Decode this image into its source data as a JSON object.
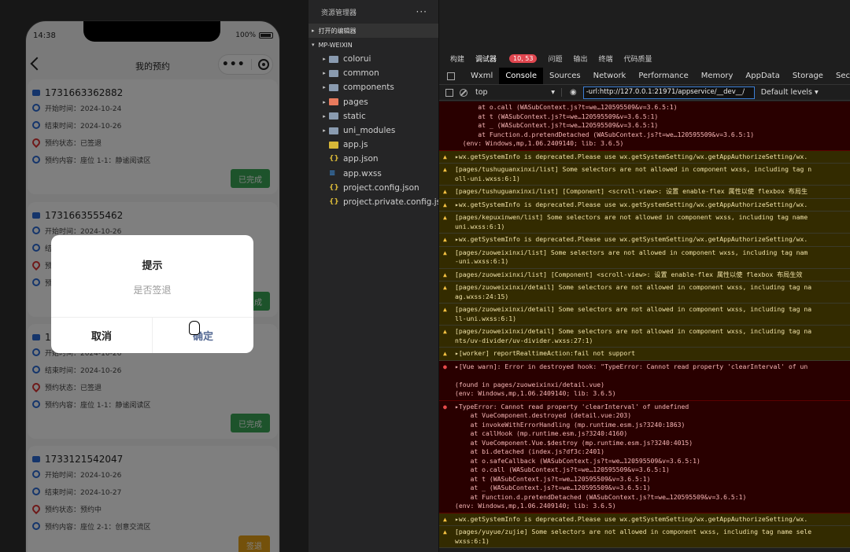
{
  "simulator": {
    "status_time": "14:38",
    "battery": "100%",
    "nav_title": "我的预约",
    "capsule_more": "•••",
    "cards": [
      {
        "id": "1731663362882",
        "start": "开始时间：2024-10-24",
        "end": "结束时间：2024-10-26",
        "status": "预约状态：已签退",
        "content": "预约内容：座位 1-1：静谧阅读区",
        "button": "已完成",
        "button_color": "#3aa757"
      },
      {
        "id": "1731663555462",
        "start": "开始时间：2024-10-26",
        "end": "结",
        "status": "预",
        "content": "预",
        "button": "成",
        "button_color": "#3aa757"
      },
      {
        "id": "1",
        "start": "开始时间：2024-10-26",
        "end": "结束时间：2024-10-26",
        "status": "预约状态：已签退",
        "content": "预约内容：座位 1-1：静谧阅读区",
        "button": "已完成",
        "button_color": "#3aa757"
      },
      {
        "id": "1733121542047",
        "start": "开始时间：2024-10-26",
        "end": "结束时间：2024-10-27",
        "status": "预约状态：预约中",
        "content": "预约内容：座位 2-1：创意交流区",
        "button": "签退",
        "button_color": "#e8a317"
      }
    ],
    "modal": {
      "title": "提示",
      "message": "是否签退",
      "cancel": "取消",
      "confirm": "确定"
    }
  },
  "explorer": {
    "title": "资源管理器",
    "more": "···",
    "section_open": "打开的编辑器",
    "section_project": "MP-WEIXIN",
    "items": [
      {
        "name": "colorui",
        "type": "folder"
      },
      {
        "name": "common",
        "type": "folder"
      },
      {
        "name": "components",
        "type": "folder"
      },
      {
        "name": "pages",
        "type": "pages"
      },
      {
        "name": "static",
        "type": "folder"
      },
      {
        "name": "uni_modules",
        "type": "folder"
      },
      {
        "name": "app.js",
        "type": "js"
      },
      {
        "name": "app.json",
        "type": "json"
      },
      {
        "name": "app.wxss",
        "type": "wxss"
      },
      {
        "name": "project.config.json",
        "type": "json"
      },
      {
        "name": "project.private.config.js...",
        "type": "json"
      }
    ]
  },
  "devtools": {
    "top_tabs": [
      "构建",
      "调试器",
      "问题",
      "输出",
      "终端",
      "代码质量"
    ],
    "badge": "10, 53",
    "tabs": [
      "Wxml",
      "Console",
      "Sources",
      "Network",
      "Performance",
      "Memory",
      "AppData",
      "Storage",
      "Securit"
    ],
    "context": "top",
    "filter": "-url:http://127.0.0.1:21971/appservice/__dev__/",
    "levels": "Default levels ▾",
    "messages": [
      {
        "level": "err",
        "lines": [
          "      at o.call (WASubContext.js?t=we…120595509&v=3.6.5:1)",
          "      at t (WASubContext.js?t=we…120595509&v=3.6.5:1)",
          "      at _ (WASubContext.js?t=we…120595509&v=3.6.5:1)",
          "      at Function.d.pretendDetached (WASubContext.js?t=we…120595509&v=3.6.5:1)",
          "  (env: Windows,mp,1.06.2409140; lib: 3.6.5)"
        ]
      },
      {
        "level": "warn",
        "lines": [
          "▸wx.getSystemInfo is deprecated.Please use wx.getSystemSetting/wx.getAppAuthorizeSetting/wx."
        ]
      },
      {
        "level": "warn",
        "lines": [
          "[pages/tushuguanxinxi/list] Some selectors are not allowed in component wxss, including tag n",
          "oll-uni.wxss:6:1)"
        ]
      },
      {
        "level": "warn",
        "lines": [
          "[pages/tushuguanxinxi/list] [Component] <scroll-view>: 设置 enable-flex 属性以使 flexbox 布局生"
        ]
      },
      {
        "level": "warn",
        "lines": [
          "▸wx.getSystemInfo is deprecated.Please use wx.getSystemSetting/wx.getAppAuthorizeSetting/wx."
        ]
      },
      {
        "level": "warn",
        "lines": [
          "[pages/kepuxinwen/list] Some selectors are not allowed in component wxss, including tag name",
          "uni.wxss:6:1)"
        ]
      },
      {
        "level": "warn",
        "lines": [
          "▸wx.getSystemInfo is deprecated.Please use wx.getSystemSetting/wx.getAppAuthorizeSetting/wx."
        ]
      },
      {
        "level": "warn",
        "lines": [
          "[pages/zuoweixinxi/list] Some selectors are not allowed in component wxss, including tag nam",
          "-uni.wxss:6:1)"
        ]
      },
      {
        "level": "warn",
        "lines": [
          "[pages/zuoweixinxi/list] [Component] <scroll-view>: 设置 enable-flex 属性以使 flexbox 布局生效"
        ]
      },
      {
        "level": "warn",
        "lines": [
          "[pages/zuoweixinxi/detail] Some selectors are not allowed in component wxss, including tag na",
          "ag.wxss:24:15)"
        ]
      },
      {
        "level": "warn",
        "lines": [
          "[pages/zuoweixinxi/detail] Some selectors are not allowed in component wxss, including tag na",
          "ll-uni.wxss:6:1)"
        ]
      },
      {
        "level": "warn",
        "lines": [
          "[pages/zuoweixinxi/detail] Some selectors are not allowed in component wxss, including tag na",
          "nts/uv-divider/uv-divider.wxss:27:1)"
        ]
      },
      {
        "level": "warn",
        "lines": [
          "▸[worker] reportRealtimeAction:fail not support"
        ]
      },
      {
        "level": "err",
        "lines": [
          "▸[Vue warn]: Error in destroyed hook: \"TypeError: Cannot read property 'clearInterval' of un",
          "",
          "(found in pages/zuoweixinxi/detail.vue)",
          "(env: Windows,mp,1.06.2409140; lib: 3.6.5)"
        ]
      },
      {
        "level": "err",
        "lines": [
          "▸TypeError: Cannot read property 'clearInterval' of undefined",
          "    at VueComponent.destroyed (detail.vue:203)",
          "    at invokeWithErrorHandling (mp.runtime.esm.js?3240:1863)",
          "    at callHook (mp.runtime.esm.js?3240:4160)",
          "    at VueComponent.Vue.$destroy (mp.runtime.esm.js?3240:4015)",
          "    at bi.detached (index.js?df3c:2401)",
          "    at o.safeCallback (WASubContext.js?t=we…120595509&v=3.6.5:1)",
          "    at o.call (WASubContext.js?t=we…120595509&v=3.6.5:1)",
          "    at t (WASubContext.js?t=we…120595509&v=3.6.5:1)",
          "    at _ (WASubContext.js?t=we…120595509&v=3.6.5:1)",
          "    at Function.d.pretendDetached (WASubContext.js?t=we…120595509&v=3.6.5:1)",
          "(env: Windows,mp,1.06.2409140; lib: 3.6.5)"
        ]
      },
      {
        "level": "warn",
        "lines": [
          "▸wx.getSystemInfo is deprecated.Please use wx.getSystemSetting/wx.getAppAuthorizeSetting/wx."
        ]
      },
      {
        "level": "warn",
        "lines": [
          "[pages/yuyue/zujie] Some selectors are not allowed in component wxss, including tag name sele",
          "wxss:6:1)"
        ]
      }
    ]
  }
}
